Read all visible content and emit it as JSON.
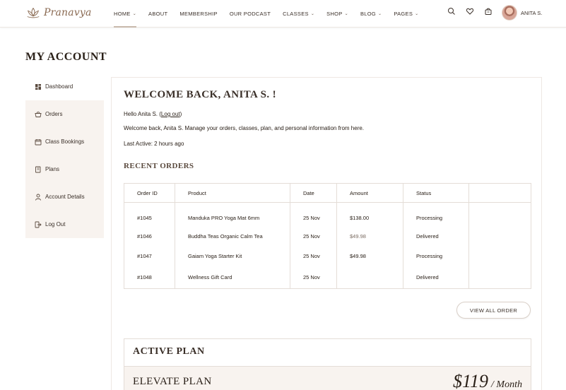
{
  "brand": {
    "name": "Pranavya",
    "accent": "#8a6a52"
  },
  "nav": {
    "items": [
      {
        "label": "HOME",
        "dropdown": true,
        "active": true
      },
      {
        "label": "ABOUT",
        "dropdown": false
      },
      {
        "label": "MEMBERSHIP",
        "dropdown": false
      },
      {
        "label": "OUR PODCAST",
        "dropdown": false
      },
      {
        "label": "CLASSES",
        "dropdown": true
      },
      {
        "label": "SHOP",
        "dropdown": true
      },
      {
        "label": "BLOG",
        "dropdown": true
      },
      {
        "label": "PAGES",
        "dropdown": true
      }
    ],
    "icons": [
      "search-icon",
      "heart-icon",
      "cart-icon"
    ],
    "user_name": "ANITA S."
  },
  "page_title": "MY ACCOUNT",
  "sidebar": {
    "items": [
      {
        "label": "Dashboard",
        "icon": "dashboard-icon"
      },
      {
        "label": "Orders",
        "icon": "basket-icon"
      },
      {
        "label": "Class Bookings",
        "icon": "calendar-icon"
      },
      {
        "label": "Plans",
        "icon": "book-icon"
      },
      {
        "label": "Account Details",
        "icon": "user-icon"
      },
      {
        "label": "Log Out",
        "icon": "logout-icon"
      }
    ]
  },
  "dashboard": {
    "welcome": "WELCOME BACK, ANITA S. !",
    "hello_prefix": "Hello Anita S. (",
    "logout_link": "Log out",
    "hello_suffix": ")",
    "intro": "Welcome back, Anita S. Manage your orders, classes, plan, and personal information from here.",
    "last_active_label": "Last Active:",
    "last_active_value": "2 hours ago",
    "recent_orders_title": "RECENT ORDERS",
    "orders_table": {
      "headers": [
        "Order ID",
        "Product",
        "Date",
        "Amount",
        "Status",
        ""
      ],
      "rows": [
        {
          "id": "#1045",
          "product": "Manduka PRO Yoga Mat 6mm",
          "date": "25 Nov",
          "amount": "$138.00",
          "status": "Processing"
        },
        {
          "id": "#1046",
          "product": "Buddha Teas Organic Calm Tea",
          "date": "25 Nov",
          "amount": "$49.98",
          "status": "Delivered"
        },
        {
          "id": "#1047",
          "product": "Gaiam Yoga Starter Kit",
          "date": "25 Nov",
          "amount": "$49.98",
          "status": "Processing"
        },
        {
          "id": "#1048",
          "product": "Wellness Gift Card",
          "date": "25 Nov",
          "amount": "",
          "status": "Delivered"
        }
      ]
    },
    "view_all_label": "VIEW ALL ORDER",
    "active_plan": {
      "title": "ACTIVE PLAN",
      "plan_name": "ELEVATE PLAN",
      "price": "$119",
      "period": "/ Month"
    }
  }
}
